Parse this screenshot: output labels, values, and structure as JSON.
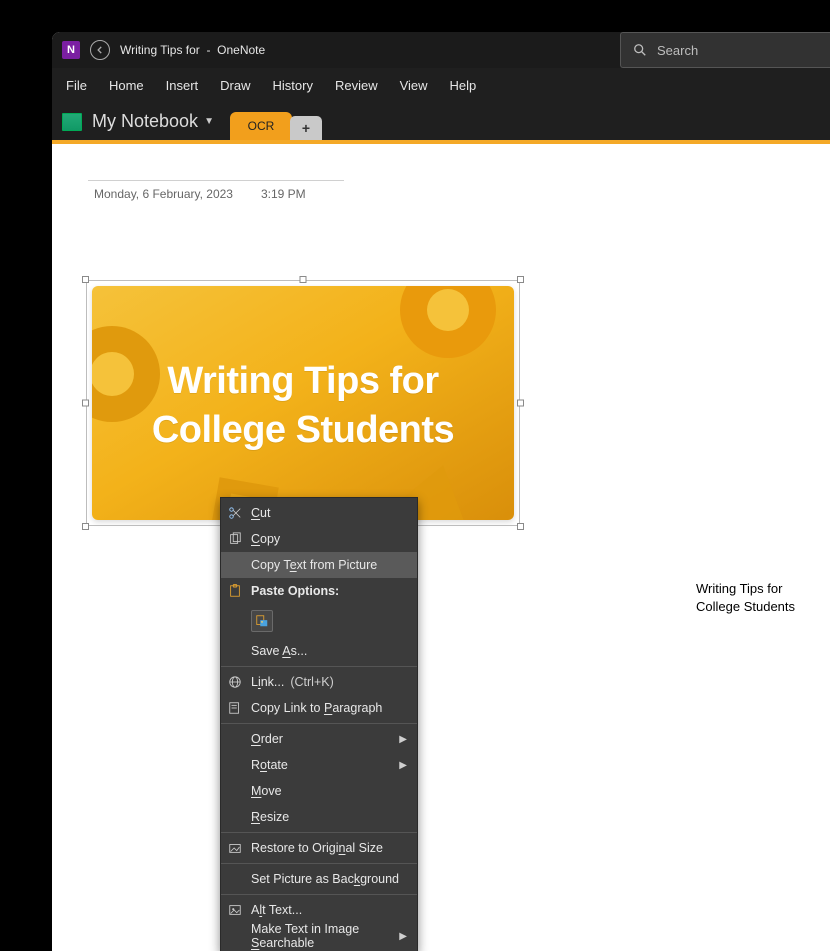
{
  "titlebar": {
    "doc_title": "Writing Tips for",
    "separator": "-",
    "app_name": "OneNote"
  },
  "search": {
    "placeholder": "Search"
  },
  "menubar": [
    "File",
    "Home",
    "Insert",
    "Draw",
    "History",
    "Review",
    "View",
    "Help"
  ],
  "notebook": {
    "label": "My Notebook"
  },
  "tabs": {
    "active": "OCR"
  },
  "page": {
    "date": "Monday, 6 February, 2023",
    "time": "3:19 PM"
  },
  "hero_image": {
    "line1": "Writing Tips for",
    "line2": "College Students"
  },
  "extracted_text": {
    "line1": "Writing Tips for",
    "line2": "College Students"
  },
  "context_menu": {
    "cut": "Cut",
    "copy": "Copy",
    "copy_text_from_picture": "Copy Text from Picture",
    "paste_options": "Paste Options:",
    "save_as": "Save As...",
    "link": "Link...",
    "link_shortcut": "(Ctrl+K)",
    "copy_link_paragraph": "Copy Link to Paragraph",
    "order": "Order",
    "rotate": "Rotate",
    "move": "Move",
    "resize": "Resize",
    "restore_original": "Restore to Original Size",
    "set_background": "Set Picture as Background",
    "alt_text": "Alt Text...",
    "make_searchable": "Make Text in Image Searchable"
  }
}
